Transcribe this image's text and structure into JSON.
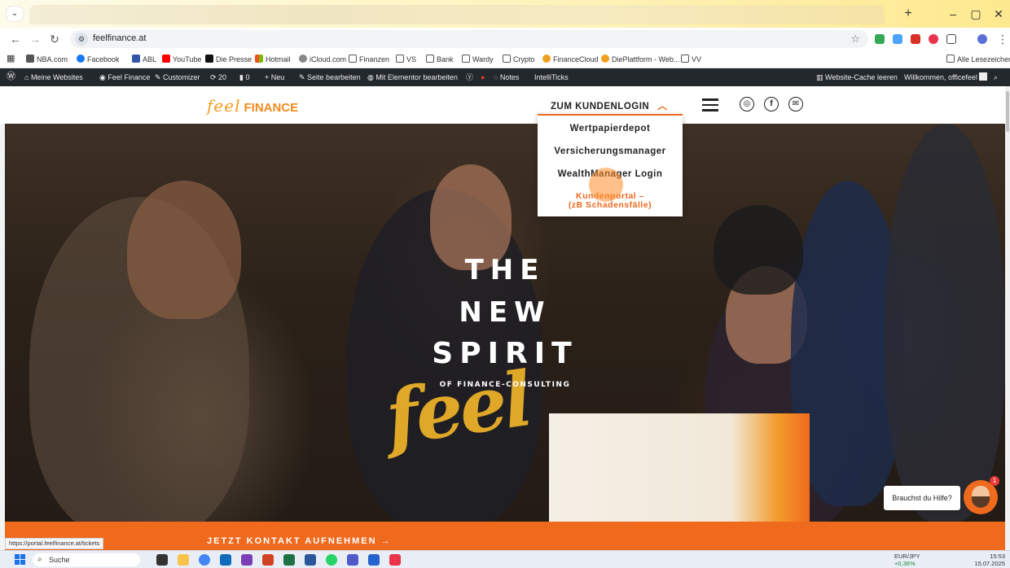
{
  "browser": {
    "url": "feelfinance.at",
    "new_tab_icon": "+",
    "window_controls": [
      "–",
      "▢",
      "✕"
    ]
  },
  "bookmarks": [
    {
      "label": "NBA.com",
      "icon": "phone-icon",
      "color": "#555555"
    },
    {
      "label": "Facebook",
      "icon": "facebook-icon",
      "color": "#1877f2"
    },
    {
      "label": "ABL",
      "icon": "abl-icon",
      "color": "#3355aa"
    },
    {
      "label": "YouTube",
      "icon": "youtube-icon",
      "color": "#ff0000"
    },
    {
      "label": "Die Presse",
      "icon": "presse-icon",
      "color": "#111111"
    },
    {
      "label": "Hotmail",
      "icon": "microsoft-icon",
      "color": "#f25022"
    },
    {
      "label": "iCloud.com",
      "icon": "apple-icon",
      "color": "#777777"
    },
    {
      "label": "Finanzen",
      "icon": "folder-icon",
      "color": "#555555"
    },
    {
      "label": "VS",
      "icon": "folder-icon",
      "color": "#555555"
    },
    {
      "label": "Bank",
      "icon": "folder-icon",
      "color": "#555555"
    },
    {
      "label": "Wardy",
      "icon": "folder-icon",
      "color": "#555555"
    },
    {
      "label": "Crypto",
      "icon": "folder-icon",
      "color": "#555555"
    },
    {
      "label": "FinanceCloud",
      "icon": "finance-cloud-icon",
      "color": "#f0a020"
    },
    {
      "label": "DiePlattform - Web...",
      "icon": "plattform-icon",
      "color": "#f0a020"
    },
    {
      "label": "VV",
      "icon": "folder-icon",
      "color": "#555555"
    }
  ],
  "all_bookmarks_label": "Alle Lesezeichen",
  "wp_admin_bar": {
    "my_sites": "Meine Websites",
    "site_name": "Feel Finance",
    "customizer": "Customizer",
    "updates_count": "20",
    "comments_count": "0",
    "new": "Neu",
    "edit_page": "Seite bearbeiten",
    "elementor": "Mit Elementor bearbeiten",
    "notes": "Notes",
    "intelliticks": "IntelliTicks",
    "clear_cache": "Website-Cache leeren",
    "welcome": "Willkommen, officefeel"
  },
  "site": {
    "logo_script": "feel",
    "logo_word": "FINANCE",
    "kundenlogin_label": "ZUM KUNDENLOGIN",
    "kundenlogin_chevron": "^",
    "dropdown_items": [
      "Wertpapierdepot",
      "Versicherungsmanager",
      "WealthManager Login"
    ],
    "dropdown_active_line1": "Kundenportal –",
    "dropdown_active_line2": "(zB Schadensfälle)",
    "social_icons": [
      "instagram-icon",
      "facebook-icon",
      "mail-icon"
    ]
  },
  "hero": {
    "line1": "THE",
    "script": "feel",
    "line2": "NEW",
    "line3": "SPIRIT",
    "subline": "OF FINANCE-CONSULTING"
  },
  "contact_bar": {
    "label": "JETZT KONTAKT AUFNEHMEN →"
  },
  "status_url": "https://portal.feelfinance.at/tickets",
  "help": {
    "bubble": "Brauchst du Hilfe?",
    "badge": "1"
  },
  "taskbar": {
    "search_placeholder": "Suche",
    "ticker_symbol": "EUR/JPY",
    "ticker_change": "+0,36%",
    "time": "15:53",
    "date": "15.07.2025"
  },
  "colors": {
    "accent": "#f06a1e",
    "brand_yellow": "#f5b82a",
    "wp_bar": "#23282d"
  }
}
